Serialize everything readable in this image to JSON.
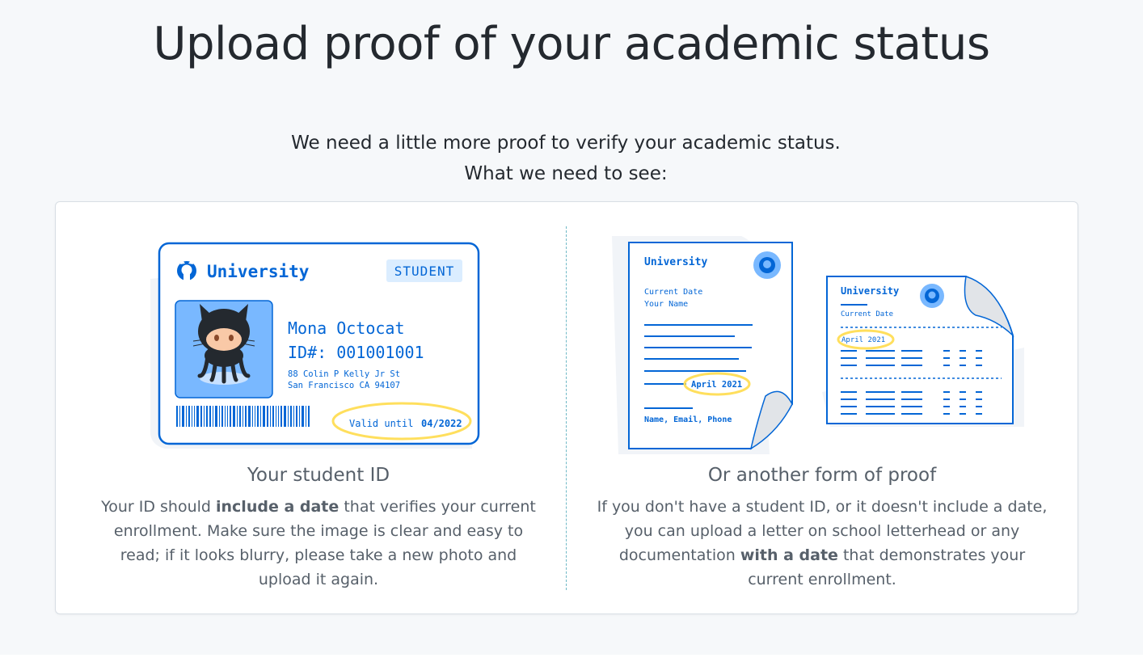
{
  "page": {
    "title": "Upload proof of your academic status",
    "subtitle_line1": "We need a little more proof to verify your academic status.",
    "subtitle_line2": "What we need to see:"
  },
  "student_id": {
    "card": {
      "institution": "University",
      "badge": "STUDENT",
      "name": "Mona Octocat",
      "id_line": "ID#: 001001001",
      "address_line1": "88 Colin P Kelly Jr St",
      "address_line2": "San Francisco CA 94107",
      "valid_label": "Valid until",
      "valid_date": "04/2022"
    },
    "heading": "Your student ID",
    "body_pre": "Your ID should ",
    "body_bold": "include a date",
    "body_post": " that verifies your current enrollment. Make sure the image is clear and easy to read; if it looks blurry, please take a new photo and upload it again."
  },
  "other_proof": {
    "letter": {
      "institution": "University",
      "current_date": "Current Date",
      "your_name": "Your Name",
      "date_stamp": "April 2021",
      "footer": "Name, Email, Phone"
    },
    "transcript": {
      "institution": "University",
      "current_date": "Current Date",
      "date_stamp": "April 2021"
    },
    "heading": "Or another form of proof",
    "body_pre": "If you don't have a student ID, or it doesn't include a date, you can upload a letter on school letterhead or any documentation ",
    "body_bold": "with a date",
    "body_post": " that demonstrates your current enrollment."
  },
  "colors": {
    "brand_blue": "#0366d6",
    "highlight_yellow": "#ffdf5d",
    "photo_bg": "#79b8ff",
    "badge_bg": "#dbedff"
  },
  "icons": [
    "github-logo-icon",
    "octocat-mascot",
    "barcode",
    "github-seal-icon"
  ]
}
